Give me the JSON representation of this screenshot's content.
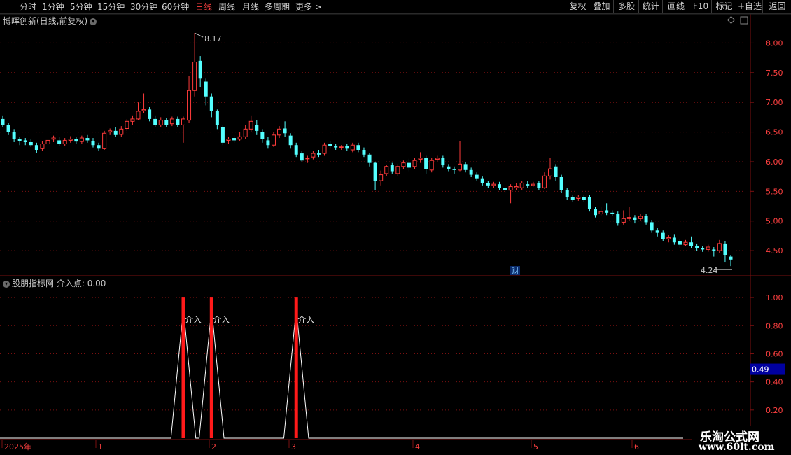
{
  "toolbar": {
    "timeframes": [
      "分时",
      "1分钟",
      "5分钟",
      "15分钟",
      "30分钟",
      "60分钟",
      "日线",
      "周线",
      "月线",
      "多周期",
      "更多 >"
    ],
    "active": "日线",
    "right_buttons": [
      "复权",
      "叠加",
      "多股",
      "统计",
      "画线",
      "F10",
      "标记",
      "+自选",
      "返回"
    ]
  },
  "main_panel": {
    "title": "博晖创新(日线,前复权)",
    "high_label": "8.17",
    "low_label": "4.24",
    "finance_marker": "财",
    "y_ticks": [
      "8.00",
      "7.50",
      "7.00",
      "6.50",
      "6.00",
      "5.50",
      "5.00",
      "4.50"
    ]
  },
  "indicator_panel": {
    "title": "股朋指标网",
    "indicator_label": "介入点: 0.00",
    "signal_text": "介入",
    "current_value": "0.49",
    "y_ticks": [
      "1.00",
      "0.80",
      "0.60",
      "0.40",
      "0.20"
    ]
  },
  "time_axis": {
    "labels": [
      "2025年",
      "1",
      "2",
      "3",
      "4",
      "5",
      "6"
    ]
  },
  "watermark": {
    "line1": "乐淘公式网",
    "line2": "www.60lt.com"
  },
  "colors": {
    "up": "#ff3b3b",
    "down": "#54ffff",
    "signal": "#ff1a1a",
    "grid": "#7a1010",
    "active_tab": "#ff4040"
  },
  "chart_data": {
    "type": "candlestick",
    "price_range": [
      4.1,
      8.3
    ],
    "candles": [
      [
        6.72,
        6.62,
        6.78,
        6.58
      ],
      [
        6.62,
        6.5,
        6.66,
        6.45
      ],
      [
        6.5,
        6.38,
        6.55,
        6.33
      ],
      [
        6.38,
        6.35,
        6.42,
        6.28
      ],
      [
        6.36,
        6.33,
        6.4,
        6.28
      ],
      [
        6.33,
        6.28,
        6.38,
        6.25
      ],
      [
        6.28,
        6.2,
        6.32,
        6.15
      ],
      [
        6.22,
        6.3,
        6.35,
        6.18
      ],
      [
        6.3,
        6.36,
        6.4,
        6.25
      ],
      [
        6.38,
        6.4,
        6.44,
        6.33
      ],
      [
        6.36,
        6.3,
        6.42,
        6.26
      ],
      [
        6.3,
        6.36,
        6.4,
        6.27
      ],
      [
        6.36,
        6.38,
        6.43,
        6.32
      ],
      [
        6.38,
        6.34,
        6.42,
        6.3
      ],
      [
        6.34,
        6.4,
        6.44,
        6.3
      ],
      [
        6.4,
        6.36,
        6.45,
        6.32
      ],
      [
        6.35,
        6.28,
        6.4,
        6.24
      ],
      [
        6.28,
        6.22,
        6.32,
        6.18
      ],
      [
        6.22,
        6.48,
        6.52,
        6.2
      ],
      [
        6.5,
        6.52,
        6.56,
        6.45
      ],
      [
        6.52,
        6.45,
        6.58,
        6.42
      ],
      [
        6.46,
        6.55,
        6.6,
        6.42
      ],
      [
        6.56,
        6.68,
        6.72,
        6.52
      ],
      [
        6.68,
        6.72,
        6.78,
        6.62
      ],
      [
        6.72,
        6.85,
        7.0,
        6.7
      ],
      [
        6.86,
        6.88,
        7.15,
        6.82
      ],
      [
        6.88,
        6.72,
        6.92,
        6.68
      ],
      [
        6.72,
        6.62,
        6.78,
        6.58
      ],
      [
        6.62,
        6.7,
        6.75,
        6.58
      ],
      [
        6.7,
        6.62,
        6.74,
        6.58
      ],
      [
        6.64,
        6.72,
        6.76,
        6.6
      ],
      [
        6.72,
        6.62,
        6.76,
        6.58
      ],
      [
        6.62,
        6.72,
        6.76,
        6.32
      ],
      [
        6.7,
        7.2,
        7.45,
        6.65
      ],
      [
        7.2,
        7.68,
        8.17,
        7.1
      ],
      [
        7.7,
        7.4,
        7.78,
        7.25
      ],
      [
        7.35,
        7.1,
        7.4,
        6.95
      ],
      [
        7.1,
        6.85,
        7.15,
        6.75
      ],
      [
        6.85,
        6.62,
        6.88,
        6.55
      ],
      [
        6.58,
        6.32,
        6.62,
        6.28
      ],
      [
        6.36,
        6.38,
        6.42,
        6.3
      ],
      [
        6.4,
        6.36,
        6.44,
        6.32
      ],
      [
        6.38,
        6.42,
        6.5,
        6.35
      ],
      [
        6.42,
        6.55,
        6.62,
        6.38
      ],
      [
        6.55,
        6.68,
        6.78,
        6.5
      ],
      [
        6.62,
        6.52,
        6.7,
        6.45
      ],
      [
        6.5,
        6.38,
        6.55,
        6.32
      ],
      [
        6.36,
        6.28,
        6.42,
        6.22
      ],
      [
        6.28,
        6.45,
        6.5,
        6.25
      ],
      [
        6.45,
        6.55,
        6.6,
        6.4
      ],
      [
        6.56,
        6.48,
        6.68,
        6.42
      ],
      [
        6.44,
        6.28,
        6.48,
        6.22
      ],
      [
        6.28,
        6.12,
        6.32,
        6.08
      ],
      [
        6.14,
        6.02,
        6.18,
        6.0
      ],
      [
        6.05,
        6.06,
        6.1,
        5.98
      ],
      [
        6.08,
        6.14,
        6.18,
        6.04
      ],
      [
        6.14,
        6.12,
        6.2,
        6.08
      ],
      [
        6.14,
        6.28,
        6.32,
        6.1
      ],
      [
        6.3,
        6.26,
        6.34,
        6.22
      ],
      [
        6.26,
        6.24,
        6.3,
        6.2
      ],
      [
        6.24,
        6.25,
        6.28,
        6.2
      ],
      [
        6.26,
        6.22,
        6.3,
        6.18
      ],
      [
        6.2,
        6.28,
        6.32,
        6.16
      ],
      [
        6.28,
        6.2,
        6.32,
        6.16
      ],
      [
        6.2,
        6.12,
        6.24,
        6.08
      ],
      [
        6.12,
        5.98,
        6.15,
        5.92
      ],
      [
        5.98,
        5.68,
        6.0,
        5.52
      ],
      [
        5.68,
        5.78,
        5.85,
        5.6
      ],
      [
        5.8,
        5.92,
        5.95,
        5.76
      ],
      [
        5.94,
        5.84,
        5.98,
        5.8
      ],
      [
        5.8,
        5.92,
        5.96,
        5.76
      ],
      [
        5.92,
        5.98,
        6.02,
        5.88
      ],
      [
        5.98,
        5.9,
        6.05,
        5.84
      ],
      [
        5.92,
        6.02,
        6.06,
        5.88
      ],
      [
        6.04,
        6.06,
        6.16,
        5.98
      ],
      [
        6.06,
        5.88,
        6.1,
        5.8
      ],
      [
        5.86,
        6.02,
        6.06,
        5.82
      ],
      [
        6.04,
        6.06,
        6.1,
        6.0
      ],
      [
        6.06,
        5.94,
        6.1,
        5.9
      ],
      [
        5.92,
        5.88,
        5.96,
        5.84
      ],
      [
        5.88,
        5.86,
        5.92,
        5.8
      ],
      [
        5.86,
        5.96,
        6.35,
        5.84
      ],
      [
        5.96,
        5.86,
        6.0,
        5.82
      ],
      [
        5.86,
        5.78,
        5.9,
        5.74
      ],
      [
        5.78,
        5.72,
        5.82,
        5.68
      ],
      [
        5.72,
        5.64,
        5.75,
        5.6
      ],
      [
        5.64,
        5.6,
        5.68,
        5.56
      ],
      [
        5.6,
        5.62,
        5.66,
        5.56
      ],
      [
        5.62,
        5.56,
        5.66,
        5.52
      ],
      [
        5.56,
        5.52,
        5.6,
        5.48
      ],
      [
        5.52,
        5.58,
        5.62,
        5.3
      ],
      [
        5.56,
        5.58,
        5.64,
        5.52
      ],
      [
        5.56,
        5.64,
        5.68,
        5.52
      ],
      [
        5.62,
        5.6,
        5.68,
        5.56
      ],
      [
        5.6,
        5.62,
        5.66,
        5.58
      ],
      [
        5.64,
        5.56,
        5.68,
        5.52
      ],
      [
        5.56,
        5.76,
        5.82,
        5.54
      ],
      [
        5.76,
        5.88,
        6.06,
        5.7
      ],
      [
        5.92,
        5.74,
        5.96,
        5.68
      ],
      [
        5.74,
        5.52,
        5.78,
        5.48
      ],
      [
        5.52,
        5.4,
        5.56,
        5.36
      ],
      [
        5.4,
        5.36,
        5.44,
        5.32
      ],
      [
        5.38,
        5.4,
        5.44,
        5.34
      ],
      [
        5.4,
        5.36,
        5.44,
        5.32
      ],
      [
        5.4,
        5.2,
        5.44,
        5.16
      ],
      [
        5.2,
        5.1,
        5.24,
        5.06
      ],
      [
        5.12,
        5.16,
        5.24,
        5.08
      ],
      [
        5.18,
        5.14,
        5.3,
        5.1
      ],
      [
        5.14,
        5.12,
        5.18,
        5.08
      ],
      [
        5.12,
        4.96,
        5.16,
        4.92
      ],
      [
        4.98,
        5.04,
        5.18,
        4.94
      ],
      [
        5.04,
        5.06,
        5.24,
        5.0
      ],
      [
        5.06,
        5.02,
        5.1,
        4.96
      ],
      [
        5.04,
        5.08,
        5.12,
        5.0
      ],
      [
        5.08,
        4.98,
        5.12,
        4.94
      ],
      [
        4.98,
        4.84,
        5.02,
        4.8
      ],
      [
        4.84,
        4.8,
        4.88,
        4.74
      ],
      [
        4.8,
        4.7,
        4.84,
        4.66
      ],
      [
        4.7,
        4.72,
        4.76,
        4.64
      ],
      [
        4.72,
        4.64,
        4.78,
        4.6
      ],
      [
        4.66,
        4.6,
        4.7,
        4.54
      ],
      [
        4.6,
        4.64,
        4.68,
        4.58
      ],
      [
        4.64,
        4.58,
        4.74,
        4.54
      ],
      [
        4.58,
        4.54,
        4.62,
        4.5
      ],
      [
        4.54,
        4.52,
        4.58,
        4.48
      ],
      [
        4.52,
        4.56,
        4.6,
        4.48
      ],
      [
        4.52,
        4.5,
        4.56,
        4.4
      ],
      [
        4.5,
        4.62,
        4.68,
        4.46
      ],
      [
        4.62,
        4.42,
        4.66,
        4.3
      ],
      [
        4.4,
        4.35,
        4.42,
        4.24
      ]
    ],
    "signal_range": [
      0,
      1.1
    ],
    "signals": [
      {
        "index": 32,
        "value": 1.0
      },
      {
        "index": 37,
        "value": 1.0
      },
      {
        "index": 52,
        "value": 1.0
      }
    ]
  }
}
